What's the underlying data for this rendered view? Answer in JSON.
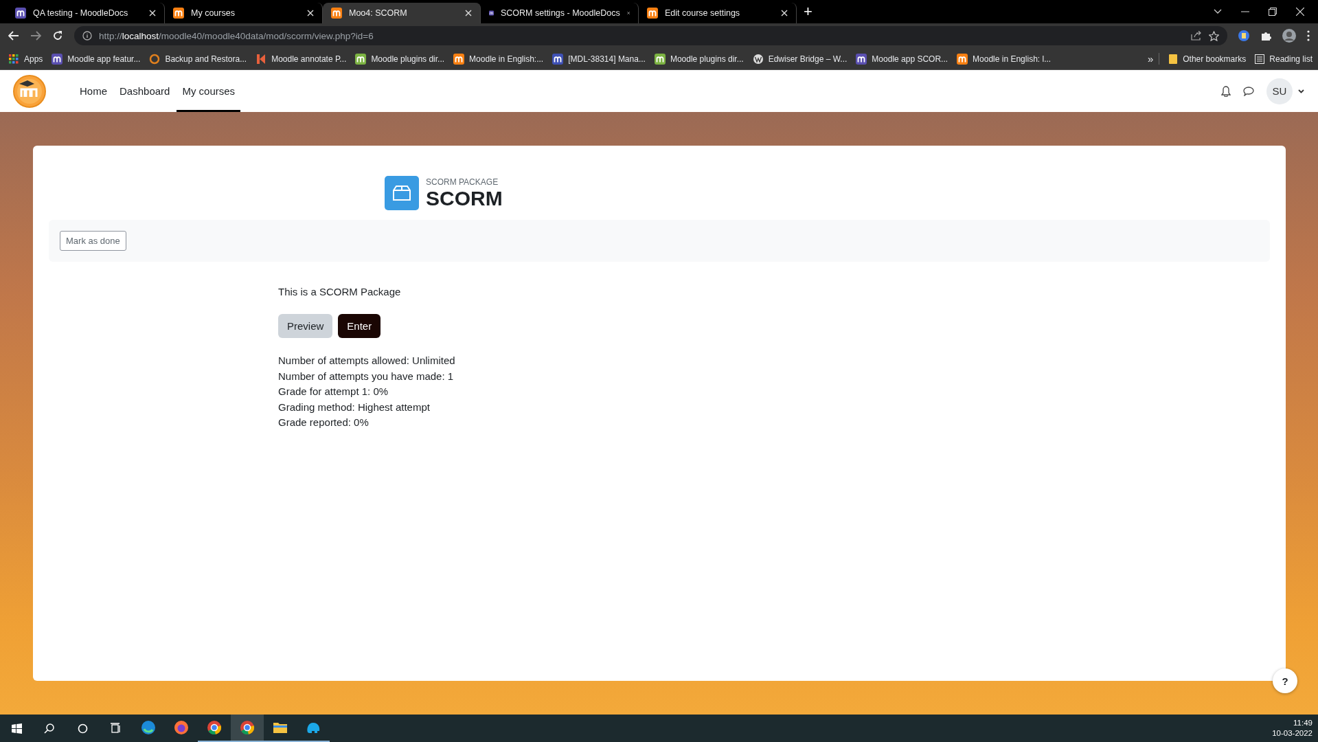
{
  "browser": {
    "tabs": [
      {
        "title": "QA testing - MoodleDocs",
        "kind": "docs",
        "selected": false
      },
      {
        "title": "My courses",
        "kind": "moodle",
        "selected": false
      },
      {
        "title": "Moo4: SCORM",
        "kind": "moodle",
        "selected": true
      },
      {
        "title": "SCORM settings - MoodleDocs",
        "kind": "docs",
        "selected": false
      },
      {
        "title": "Edit course settings",
        "kind": "moodle",
        "selected": false
      }
    ],
    "new_tab": "+",
    "url": {
      "scheme": "http://",
      "host": "localhost",
      "path": "/moodle40/moodle40data/mod/scorm/view.php?id=6"
    },
    "bookmarks": [
      {
        "label": "Apps",
        "kind": "apps"
      },
      {
        "label": "Moodle app featur...",
        "kind": "docs"
      },
      {
        "label": "Backup and Restora...",
        "kind": "ring"
      },
      {
        "label": "Moodle annotate P...",
        "kind": "annotate"
      },
      {
        "label": "Moodle plugins dir...",
        "kind": "plugins"
      },
      {
        "label": "Moodle in English:...",
        "kind": "moodle"
      },
      {
        "label": "[MDL-38314] Mana...",
        "kind": "tracker"
      },
      {
        "label": "Moodle plugins dir...",
        "kind": "plugins"
      },
      {
        "label": "Edwiser Bridge – W...",
        "kind": "wordpress"
      },
      {
        "label": "Moodle app SCOR...",
        "kind": "docs"
      },
      {
        "label": "Moodle in English: l...",
        "kind": "moodle"
      }
    ],
    "overflow": "»",
    "other_bookmarks": "Other bookmarks",
    "reading_list": "Reading list"
  },
  "site": {
    "nav": [
      {
        "label": "Home",
        "selected": false
      },
      {
        "label": "Dashboard",
        "selected": false
      },
      {
        "label": "My courses",
        "selected": true
      }
    ],
    "user_initials": "SU"
  },
  "activity": {
    "type": "SCORM PACKAGE",
    "title": "SCORM",
    "mark_done": "Mark as done",
    "description": "This is a SCORM Package",
    "buttons": [
      {
        "label": "Preview",
        "kind": "secondary"
      },
      {
        "label": "Enter",
        "kind": "primary"
      }
    ],
    "info": [
      "Number of attempts allowed: Unlimited",
      "Number of attempts you have made: 1",
      "Grade for attempt 1: 0%",
      "Grading method: Highest attempt",
      "Grade reported: 0%"
    ]
  },
  "help_button": "?",
  "taskbar": {
    "apps": [
      {
        "kind": "edge",
        "open": false,
        "selected": false
      },
      {
        "kind": "firefox",
        "open": false,
        "selected": false
      },
      {
        "kind": "chrome",
        "open": true,
        "selected": false
      },
      {
        "kind": "chrome",
        "open": true,
        "selected": true
      },
      {
        "kind": "explorer",
        "open": true,
        "selected": false
      },
      {
        "kind": "blueapp",
        "open": true,
        "selected": false
      }
    ],
    "time": "11:49",
    "date": "10-03-2022"
  }
}
